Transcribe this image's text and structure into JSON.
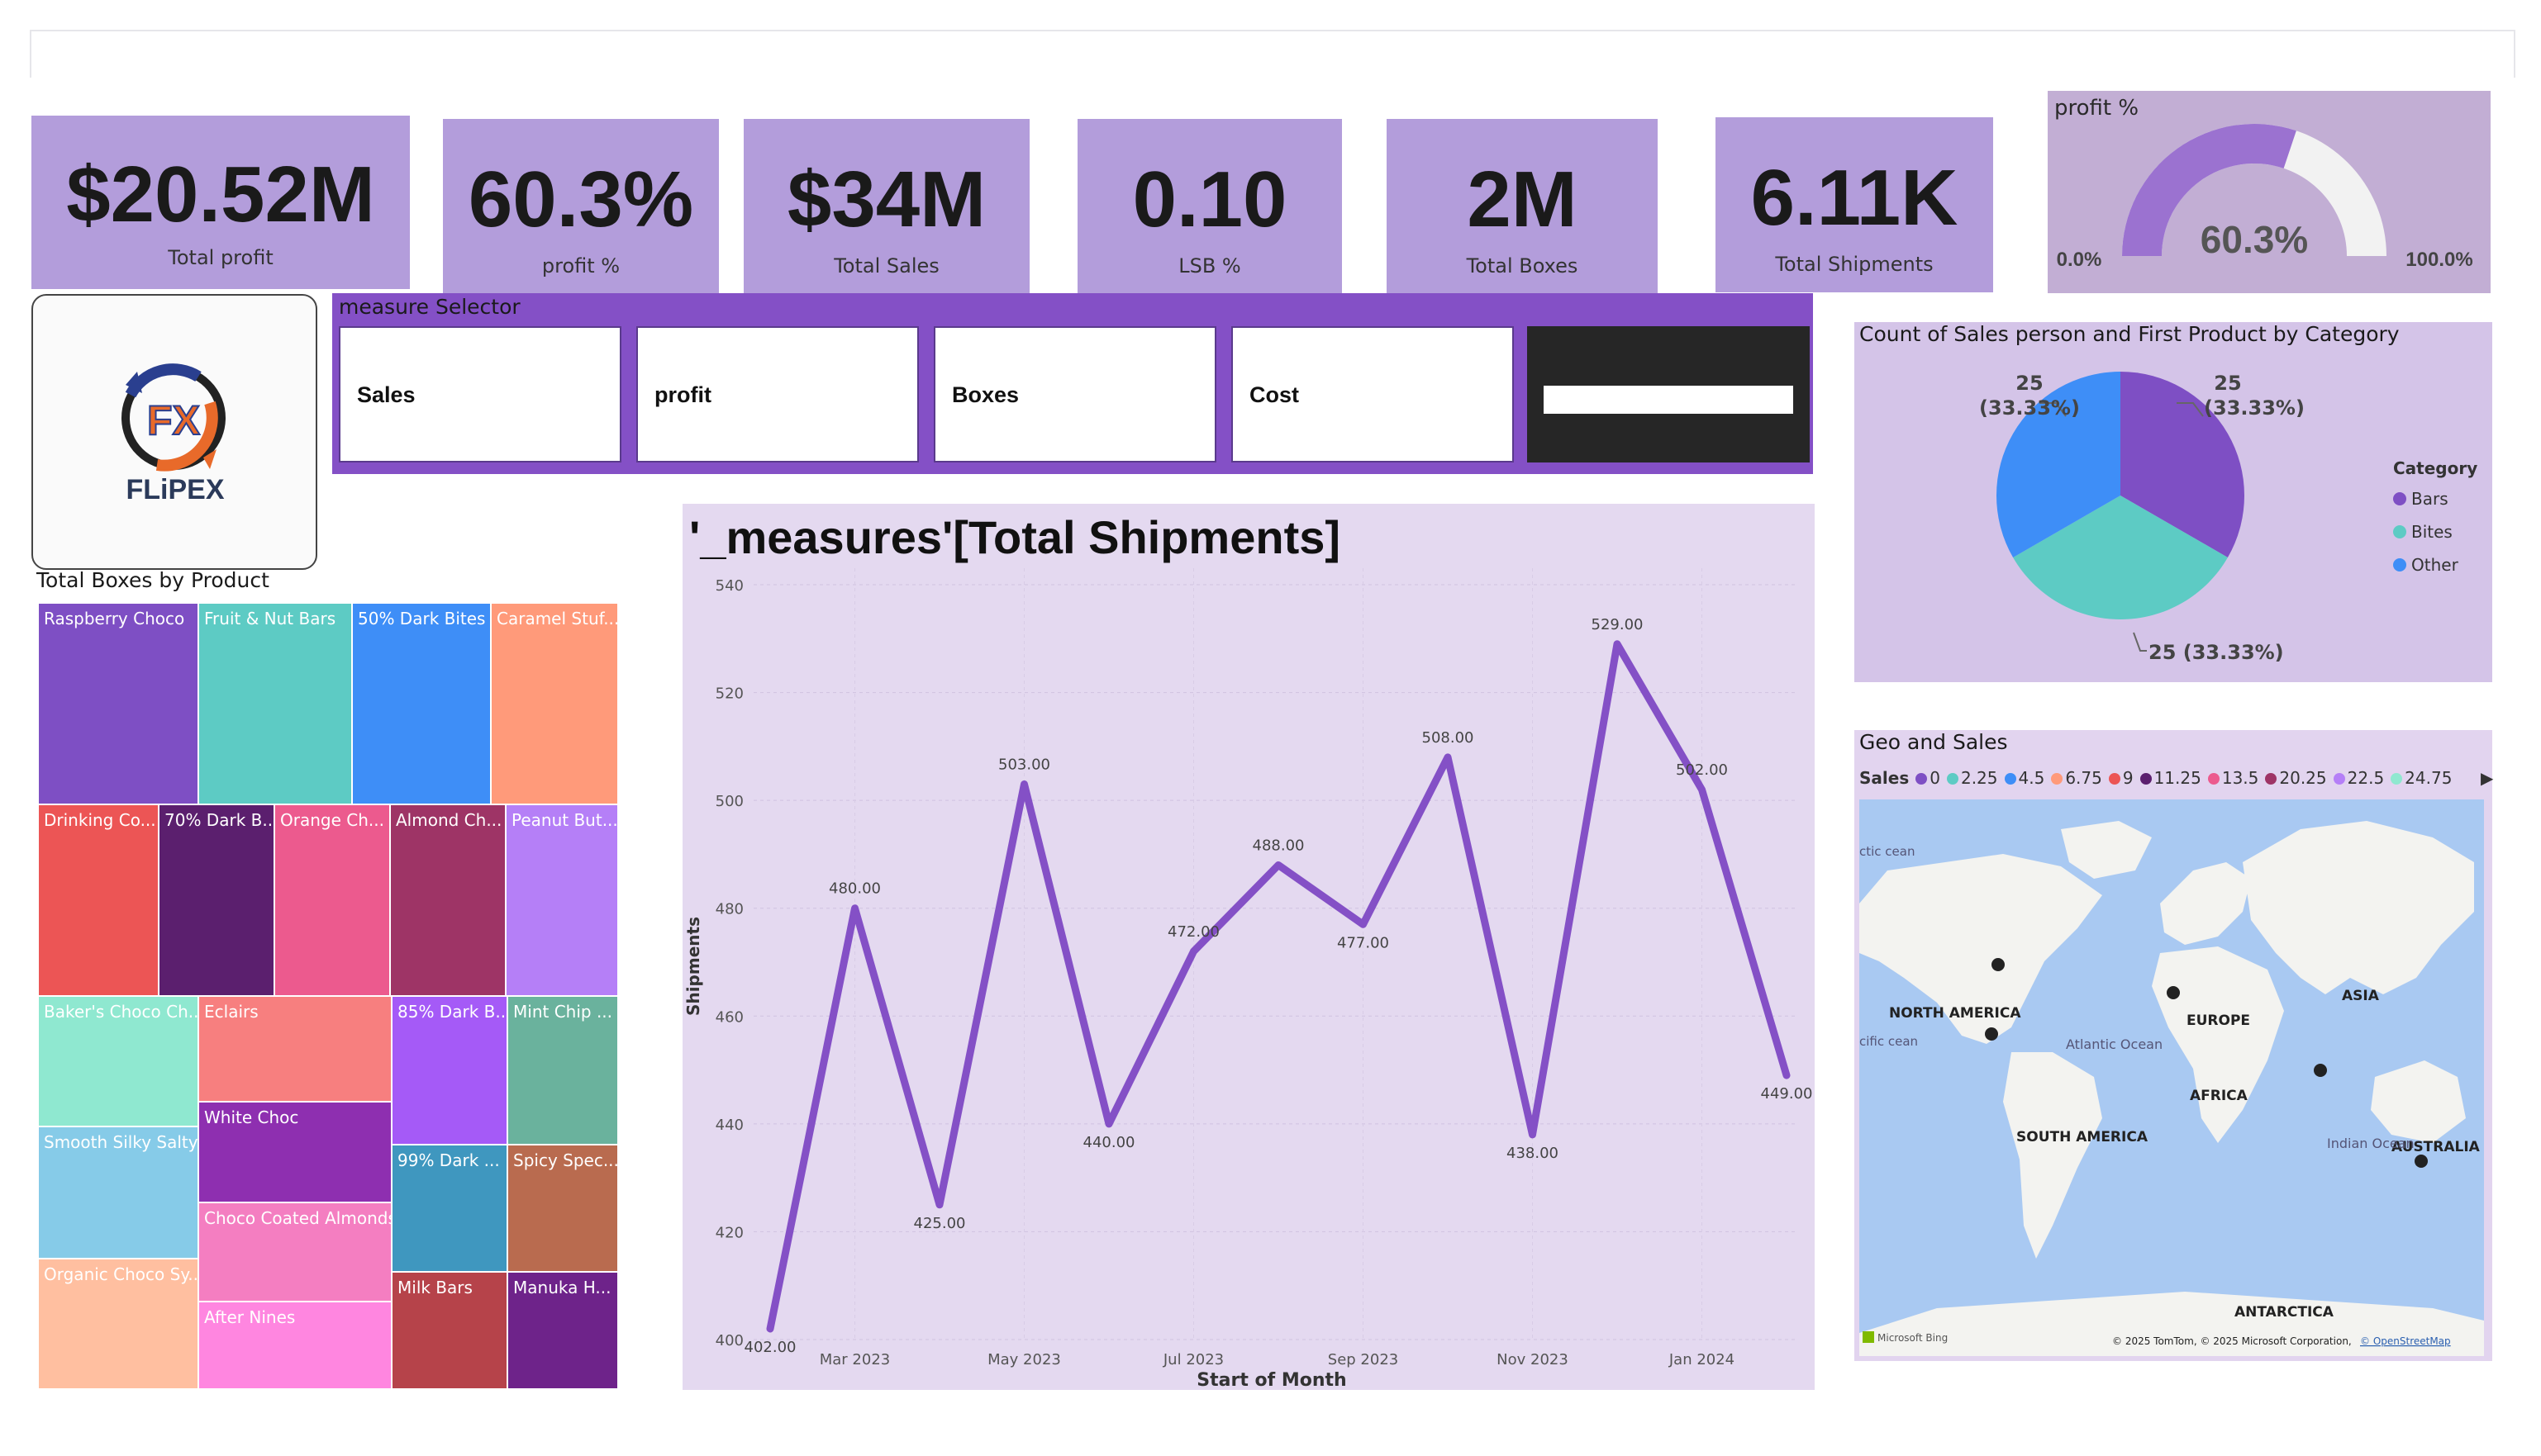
{
  "kpis": [
    {
      "value": "$20.52M",
      "label": "Total profit"
    },
    {
      "value": "60.3%",
      "label": "profit %"
    },
    {
      "value": "$34M",
      "label": "Total Sales"
    },
    {
      "value": "0.10",
      "label": "LSB %"
    },
    {
      "value": "2M",
      "label": "Total Boxes"
    },
    {
      "value": "6.11K",
      "label": "Total Shipments"
    }
  ],
  "gauge": {
    "title": "profit %",
    "value_label": "60.3%",
    "min_label": "0.0%",
    "max_label": "100.0%",
    "fraction": 0.603,
    "fill_color": "#9b72d0",
    "track_color": "#f2f2f2"
  },
  "logo": {
    "text": "FLiPEX",
    "mark": "FX"
  },
  "selector": {
    "title": "measure Selector",
    "options": [
      "Sales",
      "profit",
      "Boxes",
      "Cost"
    ]
  },
  "treemap": {
    "title": "Total Boxes by Product",
    "tiles": [
      {
        "label": "Raspberry Choco",
        "color": "#7e4fc4"
      },
      {
        "label": "Fruit & Nut Bars",
        "color": "#5dcbc4"
      },
      {
        "label": "50% Dark Bites",
        "color": "#3e8ef7"
      },
      {
        "label": "Caramel Stuf...",
        "color": "#ff9a7a"
      },
      {
        "label": "Drinking Co...",
        "color": "#ec5555"
      },
      {
        "label": "70% Dark B...",
        "color": "#5b1f6e"
      },
      {
        "label": "Orange Ch...",
        "color": "#ec5a8e"
      },
      {
        "label": "Almond Ch...",
        "color": "#9e3466"
      },
      {
        "label": "Peanut But...",
        "color": "#b57ff7"
      },
      {
        "label": "Baker's Choco Ch...",
        "color": "#8fe8d0"
      },
      {
        "label": "Eclairs",
        "color": "#f77f7f"
      },
      {
        "label": "85% Dark B...",
        "color": "#a55af7"
      },
      {
        "label": "Mint Chip ...",
        "color": "#6ab29d"
      },
      {
        "label": "White Choc",
        "color": "#8e2fb0"
      },
      {
        "label": "Smooth Silky Salty",
        "color": "#86cbe8"
      },
      {
        "label": "99% Dark ...",
        "color": "#3f97bf"
      },
      {
        "label": "Spicy Spec...",
        "color": "#b96b4f"
      },
      {
        "label": "Choco Coated Almonds",
        "color": "#f47ec1"
      },
      {
        "label": "Organic Choco Sy...",
        "color": "#ffbfa0"
      },
      {
        "label": "Milk Bars",
        "color": "#b6434a"
      },
      {
        "label": "Manuka H...",
        "color": "#6e238a"
      },
      {
        "label": "After Nines",
        "color": "#ff86e0"
      }
    ]
  },
  "line_chart": {
    "title": "'_measures'[Total Shipments]",
    "xlabel": "Start of Month",
    "ylabel": "Shipments",
    "yticks": [
      "540",
      "520",
      "500",
      "480",
      "460",
      "440",
      "420",
      "400"
    ],
    "xticks": [
      "Mar 2023",
      "May 2023",
      "Jul 2023",
      "Sep 2023",
      "Nov 2023",
      "Jan 2024"
    ]
  },
  "chart_data": [
    {
      "type": "line",
      "title": "'_measures'[Total Shipments]",
      "xlabel": "Start of Month",
      "ylabel": "Shipments",
      "x": [
        "Feb 2023",
        "Mar 2023",
        "Apr 2023",
        "May 2023",
        "Jun 2023",
        "Jul 2023",
        "Aug 2023",
        "Sep 2023",
        "Oct 2023",
        "Nov 2023",
        "Dec 2023",
        "Jan 2024",
        "Feb 2024"
      ],
      "values": [
        402,
        480,
        425,
        503,
        440,
        472,
        488,
        477,
        508,
        438,
        529,
        502,
        449
      ],
      "data_labels": [
        "402.00",
        "480.00",
        "425.00",
        "503.00",
        "440.00",
        "472.00",
        "488.00",
        "477.00",
        "508.00",
        "438.00",
        "529.00",
        "502.00",
        "449.00"
      ],
      "ylim": [
        400,
        540
      ],
      "grid": true,
      "color": "#8450c6"
    },
    {
      "type": "pie",
      "title": "Count of Sales person and First Product by Category",
      "legend_title": "Category",
      "categories": [
        "Bars",
        "Bites",
        "Other"
      ],
      "values": [
        25,
        25,
        25
      ],
      "labels": [
        "25 (33.33%)",
        "25 (33.33%)",
        "25 (33.33%)"
      ],
      "colors": [
        "#7e4fc4",
        "#5dcbc4",
        "#3e8ef7"
      ],
      "legend_position": "right"
    }
  ],
  "map": {
    "title": "Geo and Sales",
    "legend_title": "Sales",
    "legend": [
      {
        "label": "0",
        "color": "#7e4fc4"
      },
      {
        "label": "2.25",
        "color": "#5dcbc4"
      },
      {
        "label": "4.5",
        "color": "#3e8ef7"
      },
      {
        "label": "6.75",
        "color": "#ff9a7a"
      },
      {
        "label": "9",
        "color": "#ec5555"
      },
      {
        "label": "11.25",
        "color": "#5b1f6e"
      },
      {
        "label": "13.5",
        "color": "#ec5a8e"
      },
      {
        "label": "20.25",
        "color": "#9e3466"
      },
      {
        "label": "22.5",
        "color": "#b57ff7"
      },
      {
        "label": "24.75",
        "color": "#8fe8d0"
      }
    ],
    "labels": [
      "NORTH AMERICA",
      "EUROPE",
      "ASIA",
      "AFRICA",
      "SOUTH AMERICA",
      "AUSTRALIA",
      "ANTARCTICA"
    ],
    "ocean_labels": [
      "Atlantic Ocean",
      "Indian Ocean",
      "ctic cean",
      "cific cean"
    ],
    "attribution": "© 2025 TomTom, © 2025 Microsoft Corporation,",
    "attribution_link": "© OpenStreetMap",
    "bing": "Microsoft Bing"
  }
}
